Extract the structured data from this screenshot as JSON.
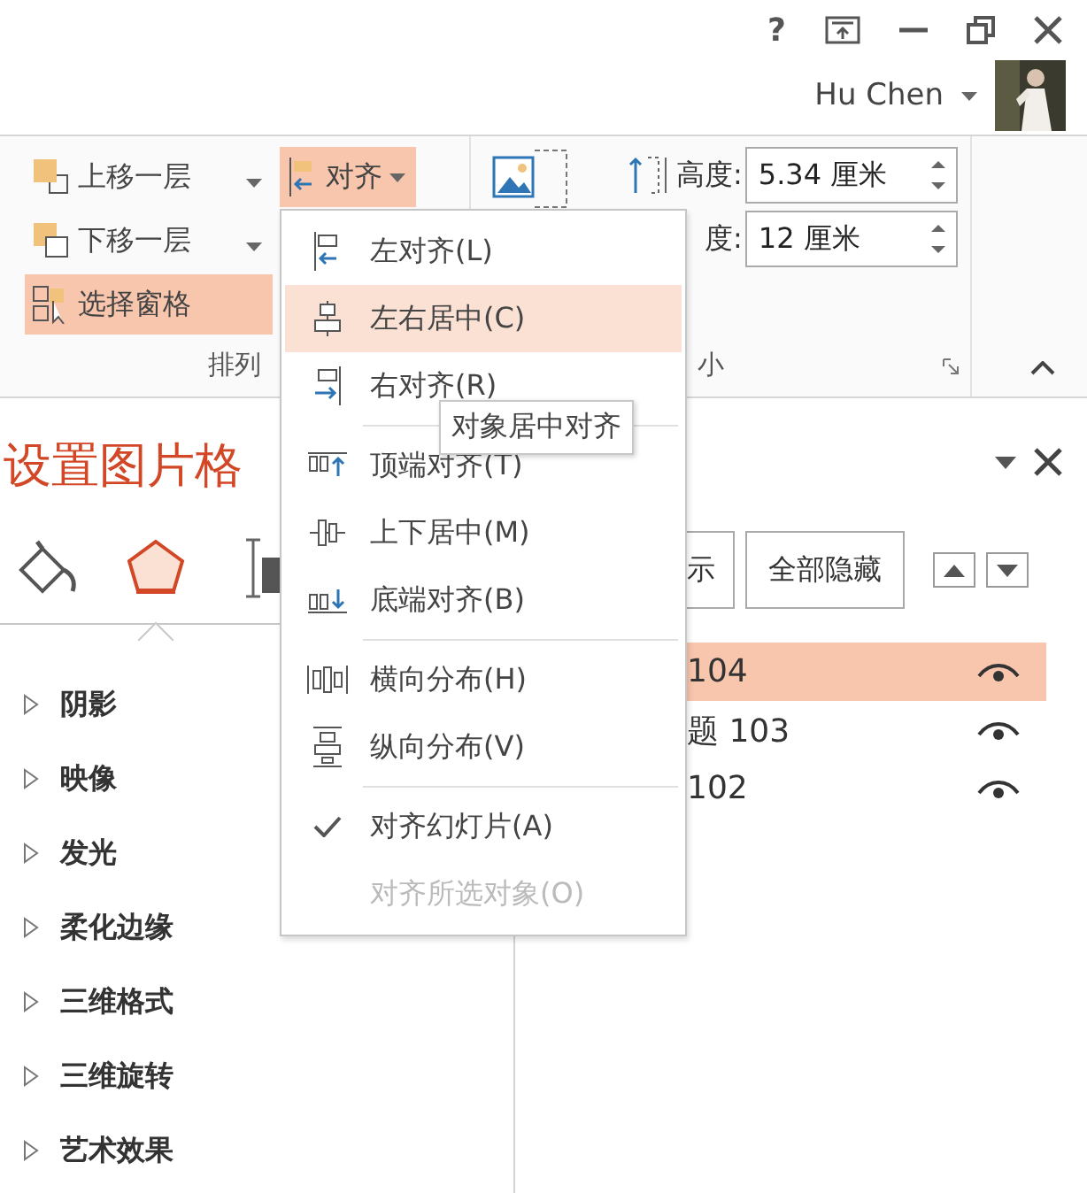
{
  "title_bar": {
    "help": "?",
    "account": {
      "name": "Hu Chen"
    }
  },
  "ribbon": {
    "arrange": {
      "label": "排列",
      "buttons": [
        {
          "label": "上移一层",
          "kind": "split",
          "selected": false
        },
        {
          "label": "下移一层",
          "kind": "split",
          "selected": false
        },
        {
          "label": "选择窗格",
          "kind": "plain",
          "selected": true
        }
      ],
      "align_button": {
        "label": "对齐",
        "selected": true
      }
    },
    "size": {
      "label": "小",
      "height": {
        "label": "高度:",
        "value": "5.34 厘米"
      },
      "width": {
        "label": "度:",
        "value": "12 厘米"
      }
    }
  },
  "format_pane": {
    "title": "设置图片格",
    "tabs": [
      {
        "kind": "fill",
        "selected": false
      },
      {
        "kind": "effects",
        "selected": true
      },
      {
        "kind": "size",
        "selected": false
      }
    ],
    "sections": [
      {
        "label": "阴影",
        "expanded": false
      },
      {
        "label": "映像",
        "expanded": false
      },
      {
        "label": "发光",
        "expanded": false
      },
      {
        "label": "柔化边缘",
        "expanded": false
      },
      {
        "label": "三维格式",
        "expanded": false
      },
      {
        "label": "三维旋转",
        "expanded": false
      },
      {
        "label": "艺术效果",
        "expanded": false
      }
    ]
  },
  "selection_pane": {
    "buttons": [
      "示",
      "全部隐藏"
    ],
    "items": [
      {
        "label": "104",
        "selected": true,
        "visible": true
      },
      {
        "label": "题 103",
        "selected": false,
        "visible": true
      },
      {
        "label": "102",
        "selected": false,
        "visible": true
      }
    ]
  },
  "align_menu": {
    "groups": [
      [
        {
          "label": "左对齐(L)",
          "kind": "left",
          "selected": false,
          "checked": false,
          "disabled": false
        },
        {
          "label": "左右居中(C)",
          "kind": "center",
          "selected": true,
          "checked": false,
          "disabled": false
        },
        {
          "label": "右对齐(R)",
          "kind": "right",
          "selected": false,
          "checked": false,
          "disabled": false
        }
      ],
      [
        {
          "label": "顶端对齐(T)",
          "kind": "top",
          "selected": false,
          "checked": false,
          "disabled": false
        },
        {
          "label": "上下居中(M)",
          "kind": "middle",
          "selected": false,
          "checked": false,
          "disabled": false
        },
        {
          "label": "底端对齐(B)",
          "kind": "bottom",
          "selected": false,
          "checked": false,
          "disabled": false
        }
      ],
      [
        {
          "label": "横向分布(H)",
          "kind": "hdist",
          "selected": false,
          "checked": false,
          "disabled": false
        },
        {
          "label": "纵向分布(V)",
          "kind": "vdist",
          "selected": false,
          "checked": false,
          "disabled": false
        }
      ],
      [
        {
          "label": "对齐幻灯片(A)",
          "kind": "option",
          "selected": false,
          "checked": true,
          "disabled": false
        },
        {
          "label": "对齐所选对象(O)",
          "kind": "option",
          "selected": false,
          "checked": false,
          "disabled": true
        }
      ]
    ],
    "tooltip": "对象居中对齐"
  }
}
